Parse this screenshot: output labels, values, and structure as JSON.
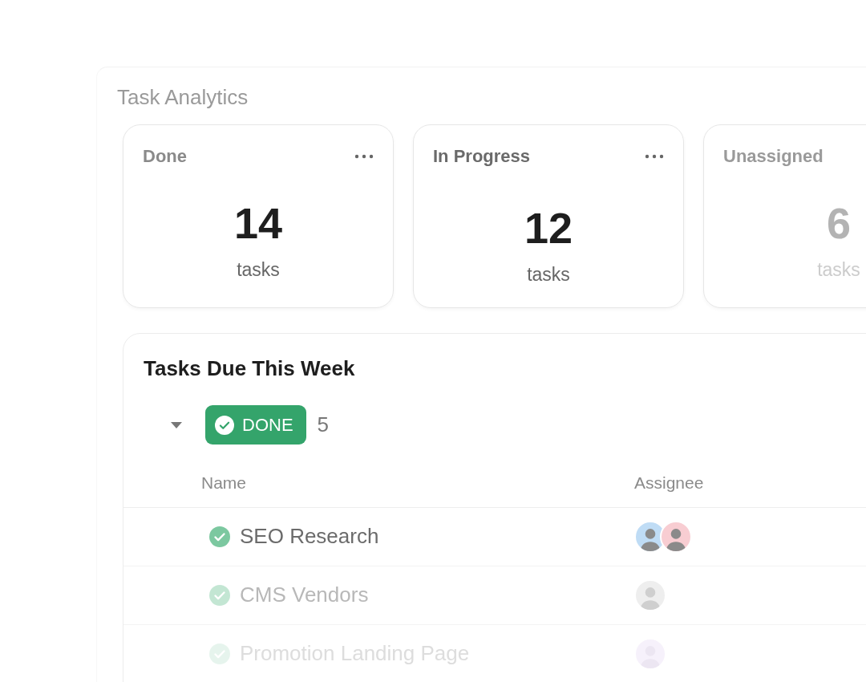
{
  "title": "Task Analytics",
  "stats": [
    {
      "label": "Done",
      "value": "14",
      "unit": "tasks",
      "has_menu": true
    },
    {
      "label": "In Progress",
      "value": "12",
      "unit": "tasks",
      "has_menu": true
    },
    {
      "label": "Unassigned",
      "value": "6",
      "unit": "tasks",
      "has_menu": false
    }
  ],
  "due_panel": {
    "title": "Tasks Due This Week",
    "groups": [
      {
        "status": "DONE",
        "count": "5",
        "expanded": true,
        "columns": [
          "Name",
          "Assignee"
        ],
        "rows": [
          {
            "name": "SEO Research",
            "done": true,
            "assignees": [
              {
                "color": "#bfdcf5"
              },
              {
                "color": "#f8cdd2"
              }
            ]
          },
          {
            "name": "CMS Vendors",
            "done": true,
            "assignees": [
              {
                "color": "#eeeeee"
              }
            ]
          },
          {
            "name": "Promotion Landing Page",
            "done": true,
            "assignees": [
              {
                "color": "#f6f1fb"
              }
            ]
          }
        ]
      }
    ]
  }
}
